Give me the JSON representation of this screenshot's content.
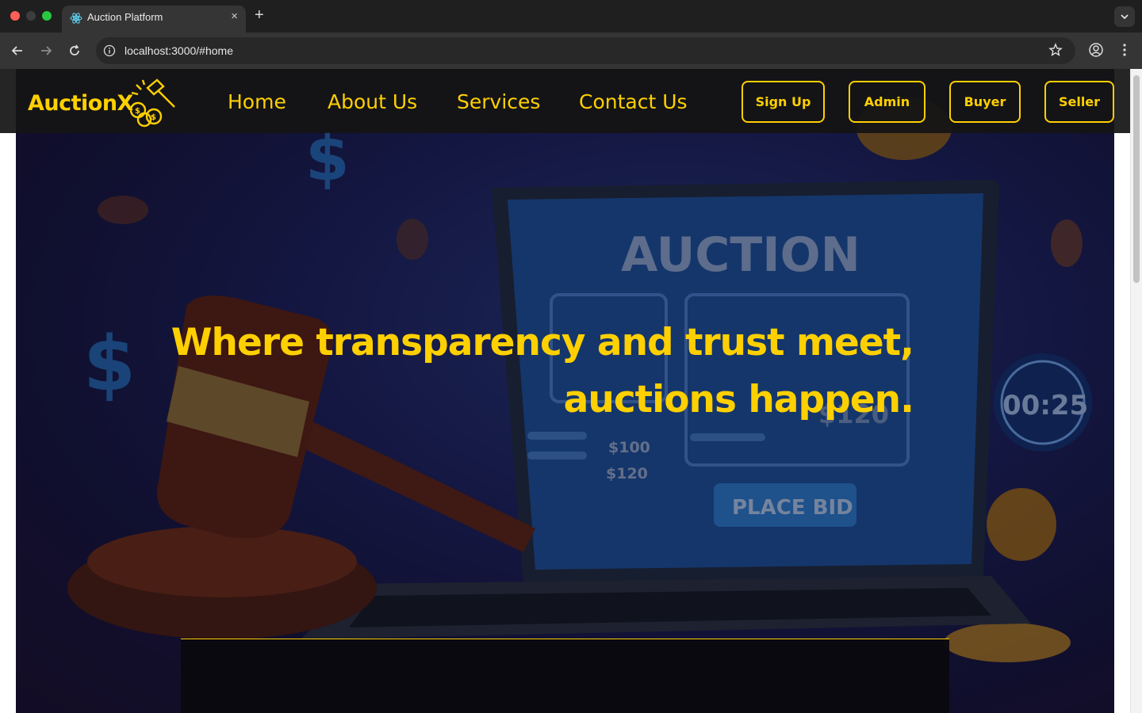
{
  "browser": {
    "tab_title": "Auction Platform",
    "tab_close": "×",
    "new_tab": "+",
    "url": "localhost:3000/#home"
  },
  "navbar": {
    "logo": "AuctionX",
    "links": [
      "Home",
      "About Us",
      "Services",
      "Contact Us"
    ],
    "buttons": [
      "Sign Up",
      "Admin",
      "Buyer",
      "Seller"
    ]
  },
  "hero": {
    "headline_line1": "Where transparency and trust meet,",
    "headline_line2": "auctions happen.",
    "laptop_screen_title": "AUCTION",
    "laptop_bid_1": "$100",
    "laptop_bid_2": "$120",
    "laptop_bid_3": "$120",
    "place_bid": "PLACE BID",
    "timer": "00:25"
  },
  "colors": {
    "accent": "#ffd000",
    "navbar_bg": "#141414"
  }
}
